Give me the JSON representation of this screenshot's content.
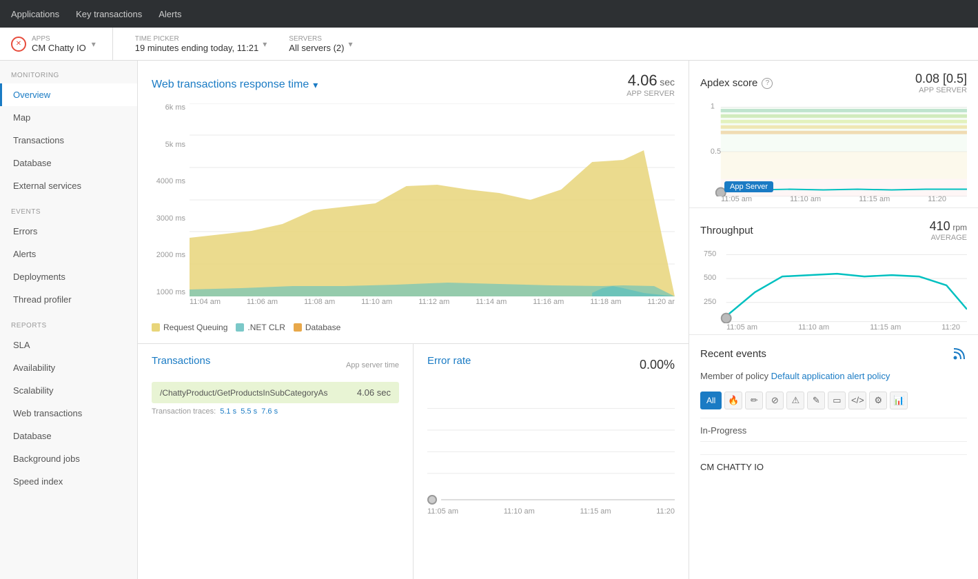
{
  "topNav": {
    "items": [
      "Applications",
      "Key transactions",
      "Alerts"
    ]
  },
  "appBar": {
    "appsLabel": "APPS",
    "appName": "CM Chatty IO",
    "timePicker": {
      "label": "TIME PICKER",
      "value": "19 minutes ending today, 11:21"
    },
    "servers": {
      "label": "SERVERS",
      "value": "All servers (2)"
    }
  },
  "sidebar": {
    "monitoring": {
      "label": "MONITORING",
      "items": [
        {
          "id": "overview",
          "label": "Overview",
          "active": true
        },
        {
          "id": "map",
          "label": "Map",
          "active": false
        },
        {
          "id": "transactions",
          "label": "Transactions",
          "active": false
        },
        {
          "id": "database",
          "label": "Database",
          "active": false
        },
        {
          "id": "external-services",
          "label": "External services",
          "active": false
        }
      ]
    },
    "events": {
      "label": "EVENTS",
      "items": [
        {
          "id": "errors",
          "label": "Errors",
          "active": false
        },
        {
          "id": "alerts",
          "label": "Alerts",
          "active": false
        },
        {
          "id": "deployments",
          "label": "Deployments",
          "active": false
        },
        {
          "id": "thread-profiler",
          "label": "Thread profiler",
          "active": false
        }
      ]
    },
    "reports": {
      "label": "REPORTS",
      "items": [
        {
          "id": "sla",
          "label": "SLA",
          "active": false
        },
        {
          "id": "availability",
          "label": "Availability",
          "active": false
        },
        {
          "id": "scalability",
          "label": "Scalability",
          "active": false
        },
        {
          "id": "web-transactions",
          "label": "Web transactions",
          "active": false
        },
        {
          "id": "database-report",
          "label": "Database",
          "active": false
        },
        {
          "id": "background-jobs",
          "label": "Background jobs",
          "active": false
        },
        {
          "id": "speed-index",
          "label": "Speed index",
          "active": false
        }
      ]
    }
  },
  "mainChart": {
    "title": "Web transactions response time",
    "value": "4.06",
    "unit": "sec",
    "metaLabel": "APP SERVER",
    "yLabels": [
      "6k ms",
      "5k ms",
      "4000 ms",
      "3000 ms",
      "2000 ms",
      "1000 ms"
    ],
    "xLabels": [
      "11:04 am",
      "11:06 am",
      "11:08 am",
      "11:10 am",
      "11:12 am",
      "11:14 am",
      "11:16 am",
      "11:18 am",
      "11:20 ar"
    ],
    "legend": [
      {
        "id": "request-queuing",
        "label": "Request Queuing",
        "color": "#e8d57a"
      },
      {
        "id": "dotnet-clr",
        "label": ".NET CLR",
        "color": "#7bc8c8"
      },
      {
        "id": "database",
        "label": "Database",
        "color": "#e8a84a"
      }
    ]
  },
  "transactions": {
    "title": "Transactions",
    "subtitle": "App server time",
    "items": [
      {
        "name": "/ChattyProduct/GetProductsInSubCategoryAs",
        "time": "4.06 sec"
      }
    ],
    "traces": {
      "label": "Transaction traces:",
      "links": [
        "5.1 s",
        "5.5 s",
        "7.6 s"
      ]
    }
  },
  "errorRate": {
    "title": "Error rate",
    "value": "0.00",
    "unit": "%",
    "xLabels": [
      "11:05 am",
      "11:10 am",
      "11:15 am",
      "11:20"
    ]
  },
  "apdex": {
    "title": "Apdex score",
    "value": "0.08 [0.5]",
    "metaLabel": "APP SERVER",
    "yLabels": [
      "1",
      "0.5"
    ],
    "xLabels": [
      "11:05 am",
      "11:10 am",
      "11:15 am",
      "11:20"
    ],
    "badgeLabel": "App Server"
  },
  "throughput": {
    "title": "Throughput",
    "value": "410",
    "unit": "rpm",
    "avgLabel": "AVERAGE",
    "yLabels": [
      "750",
      "500",
      "250"
    ],
    "xLabels": [
      "11:05 am",
      "11:10 am",
      "11:15 am",
      "11:20"
    ]
  },
  "recentEvents": {
    "title": "Recent events",
    "policyText": "Member of policy",
    "policyLink": "Default application alert policy",
    "filters": [
      {
        "id": "all",
        "label": "All",
        "active": true
      },
      {
        "id": "fire",
        "icon": "🔥",
        "active": false
      },
      {
        "id": "pencil",
        "icon": "✏️",
        "active": false
      },
      {
        "id": "block",
        "icon": "⊘",
        "active": false
      },
      {
        "id": "warning",
        "icon": "⚠",
        "active": false
      },
      {
        "id": "edit2",
        "icon": "✎",
        "active": false
      },
      {
        "id": "monitor",
        "icon": "🖥",
        "active": false
      },
      {
        "id": "code",
        "icon": "</>",
        "active": false
      },
      {
        "id": "gear",
        "icon": "⚙",
        "active": false
      },
      {
        "id": "chart",
        "icon": "📊",
        "active": false
      }
    ],
    "inProgress": "In-Progress",
    "appName": "CM CHATTY IO"
  }
}
